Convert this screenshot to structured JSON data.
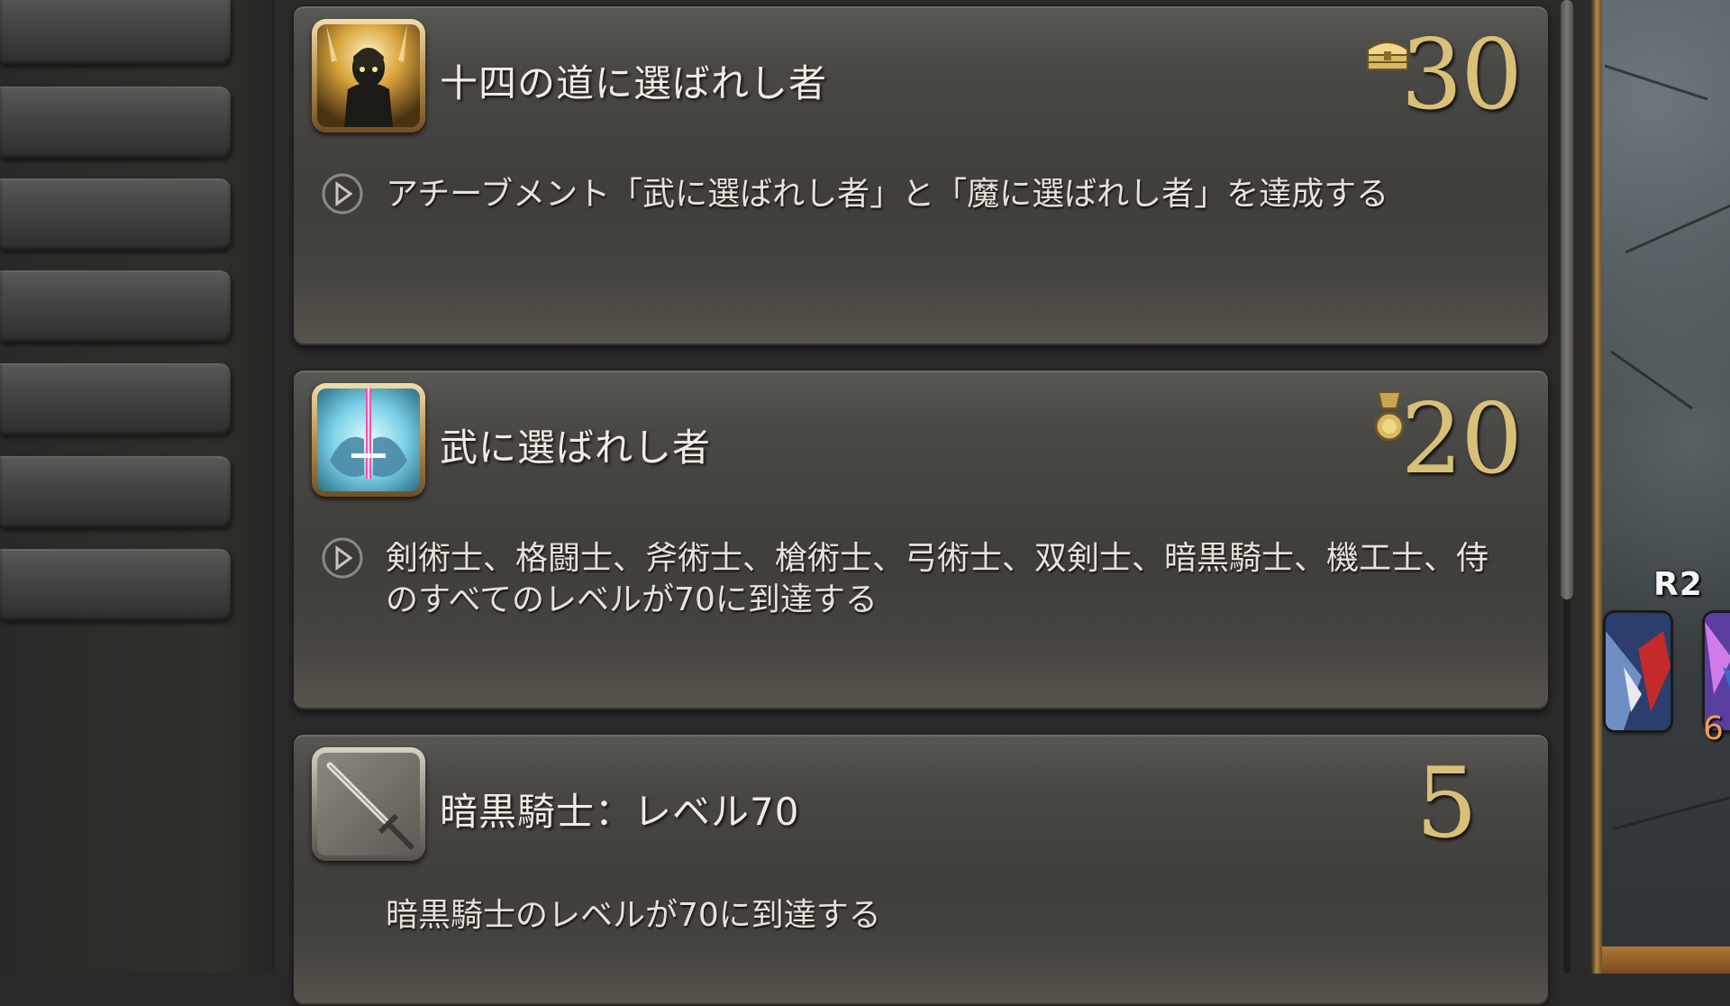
{
  "achievements": [
    {
      "title": "十四の道に選ばれし者",
      "description": "アチーブメント「武に選ばれし者」と「魔に選ばれし者」を達成する",
      "points": "30",
      "reward_icon": "treasure-chest-icon",
      "icon": "dark-knight-portrait-icon",
      "has_linked_achievements": true
    },
    {
      "title": "武に選ばれし者",
      "description": "剣術士、格闘士、斧術士、槍術士、弓術士、双剣士、暗黒騎士、機工士、侍のすべてのレベルが70に到達する",
      "points": "20",
      "reward_icon": "medal-icon",
      "icon": "glowing-sword-icon",
      "has_linked_achievements": true
    },
    {
      "title": "暗黒騎士：レベル70",
      "description": "暗黒騎士のレベルが70に到達する",
      "points": "5",
      "reward_icon": null,
      "icon": "greatsword-icon",
      "has_linked_achievements": false
    }
  ],
  "hotbar": {
    "label": "R2",
    "number": "6"
  },
  "colors": {
    "points_gold": "#d8c078",
    "card_bg": "#4a4845",
    "panel_bg": "#2c2b29",
    "frame_gold": "#b9904f"
  }
}
